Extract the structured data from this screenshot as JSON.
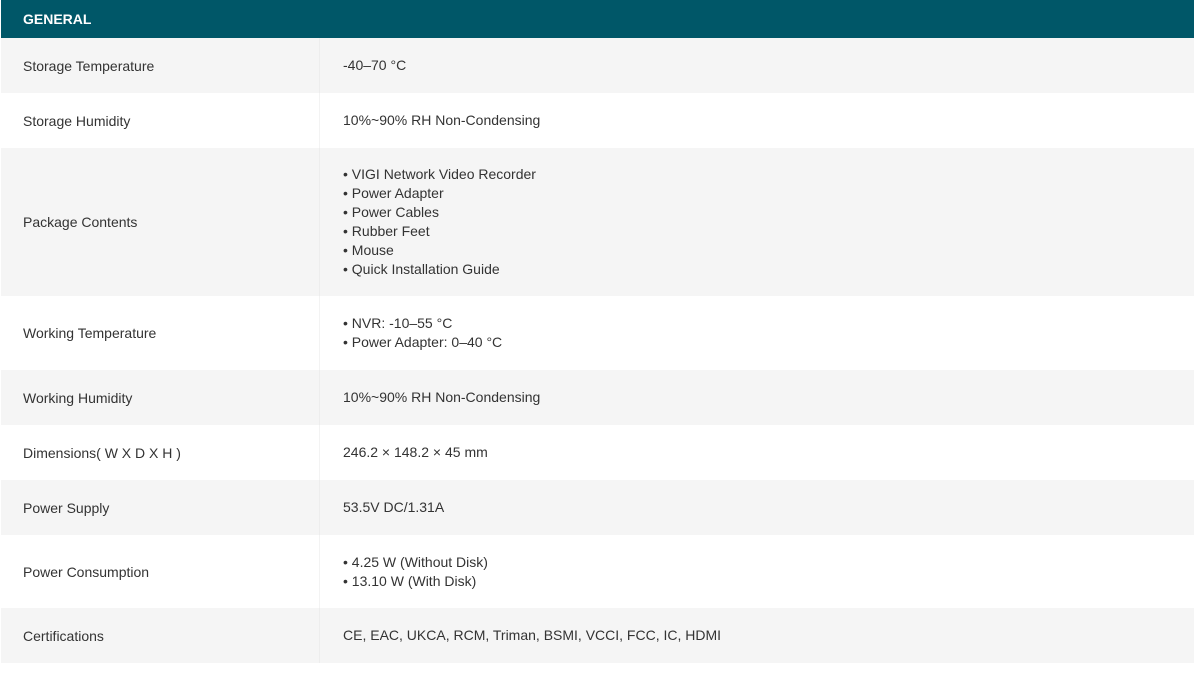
{
  "section": {
    "title": "GENERAL"
  },
  "rows": [
    {
      "label": "Storage Temperature",
      "values": [
        "-40–70 °C"
      ]
    },
    {
      "label": "Storage Humidity",
      "values": [
        "10%~90% RH Non-Condensing"
      ]
    },
    {
      "label": "Package Contents",
      "values": [
        "• VIGI Network Video Recorder",
        "• Power Adapter",
        "• Power Cables",
        "• Rubber Feet",
        "• Mouse",
        "• Quick Installation Guide"
      ]
    },
    {
      "label": "Working Temperature",
      "values": [
        "• NVR: -10–55 °C",
        "• Power Adapter: 0–40 °C"
      ]
    },
    {
      "label": "Working Humidity",
      "values": [
        "10%~90% RH Non-Condensing"
      ]
    },
    {
      "label": "Dimensions( W X D X H )",
      "values": [
        "246.2 × 148.2 × 45 mm"
      ]
    },
    {
      "label": "Power Supply",
      "values": [
        "53.5V DC/1.31A"
      ]
    },
    {
      "label": "Power Consumption",
      "values": [
        "• 4.25 W (Without Disk)",
        "• 13.10 W (With Disk)"
      ]
    },
    {
      "label": "Certifications",
      "values": [
        "CE, EAC, UKCA, RCM, Triman, BSMI, VCCI, FCC, IC, HDMI"
      ]
    }
  ],
  "colors": {
    "header_bg": "#005768",
    "header_text": "#ffffff",
    "row_alt_bg": "#f5f5f5",
    "row_bg": "#ffffff",
    "text": "#333333"
  }
}
